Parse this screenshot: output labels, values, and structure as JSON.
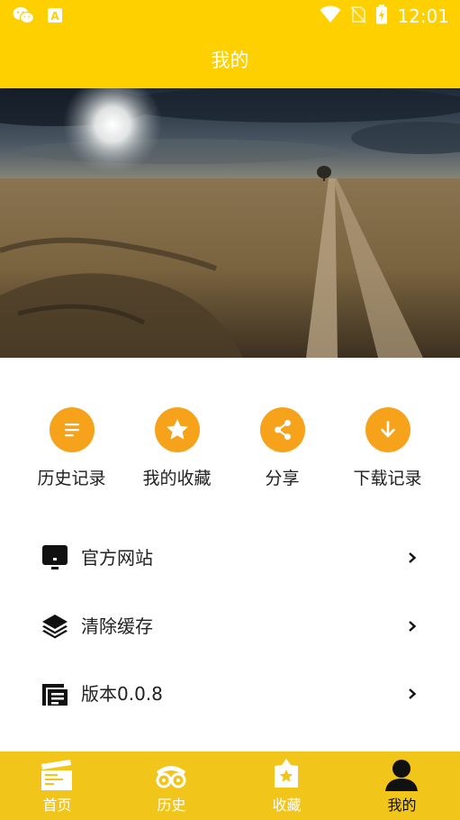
{
  "status_bar": {
    "time": "12:01",
    "left_icons": [
      "wechat-icon",
      "keyboard-a-icon"
    ],
    "right_icons": [
      "wifi-icon",
      "no-sim-icon",
      "battery-charging-icon"
    ]
  },
  "header": {
    "title": "我的"
  },
  "banner": {
    "image": "desert-road-sunset-landscape"
  },
  "quick_actions": [
    {
      "label": "历史记录",
      "icon": "list-icon"
    },
    {
      "label": "我的收藏",
      "icon": "star-icon"
    },
    {
      "label": "分享",
      "icon": "share-icon"
    },
    {
      "label": "下载记录",
      "icon": "download-icon"
    }
  ],
  "menu": [
    {
      "label": "官方网站",
      "icon": "monitor-icon"
    },
    {
      "label": "清除缓存",
      "icon": "layers-icon"
    },
    {
      "label": "版本0.0.8",
      "icon": "version-icon"
    }
  ],
  "bottom_nav": {
    "tabs": [
      {
        "label": "首页",
        "icon": "clapperboard-icon"
      },
      {
        "label": "历史",
        "icon": "film-reel-icon"
      },
      {
        "label": "收藏",
        "icon": "star-bag-icon"
      },
      {
        "label": "我的",
        "icon": "user-icon"
      }
    ],
    "active": "我的"
  },
  "colors": {
    "primary": "#FFD000",
    "bottom_nav": "#F2C51A",
    "accent_orange": "#F7A21B",
    "text": "#212121",
    "white": "#FFFFFF"
  }
}
